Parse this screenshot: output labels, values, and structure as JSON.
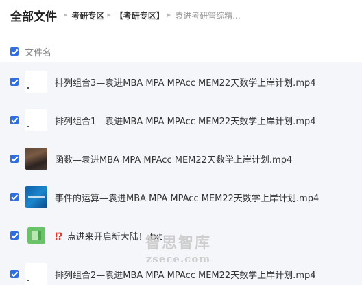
{
  "header": {
    "title": "全部文件",
    "breadcrumbs": [
      "考研专区",
      "【考研专区】",
      "袁进考研管综精..."
    ]
  },
  "column": {
    "name_label": "文件名"
  },
  "files": [
    {
      "name": "排列组合3—袁进MBA MPA MPAcc MEM22天数学上岸计划.mp4",
      "thumb": "white"
    },
    {
      "name": "排列组合1—袁进MBA MPA MPAcc MEM22天数学上岸计划.mp4",
      "thumb": "white"
    },
    {
      "name": "函数—袁进MBA MPA MPAcc MEM22天数学上岸计划.mp4",
      "thumb": "photo"
    },
    {
      "name": "事件的运算—袁进MBA MPA MPAcc MEM22天数学上岸计划.mp4",
      "thumb": "blue"
    },
    {
      "name": "点进来开启新大陆！.txt",
      "prefix": "⁉",
      "thumb": "doc"
    },
    {
      "name": "排列组合2—袁进MBA MPA MPAcc MEM22天数学上岸计划.mp4",
      "thumb": "white"
    }
  ],
  "watermark": {
    "cn": "智思智库",
    "url": "zsece.com"
  },
  "colors": {
    "checkbox": "#2f6fe0",
    "row_bg": "#f5f6fa"
  }
}
